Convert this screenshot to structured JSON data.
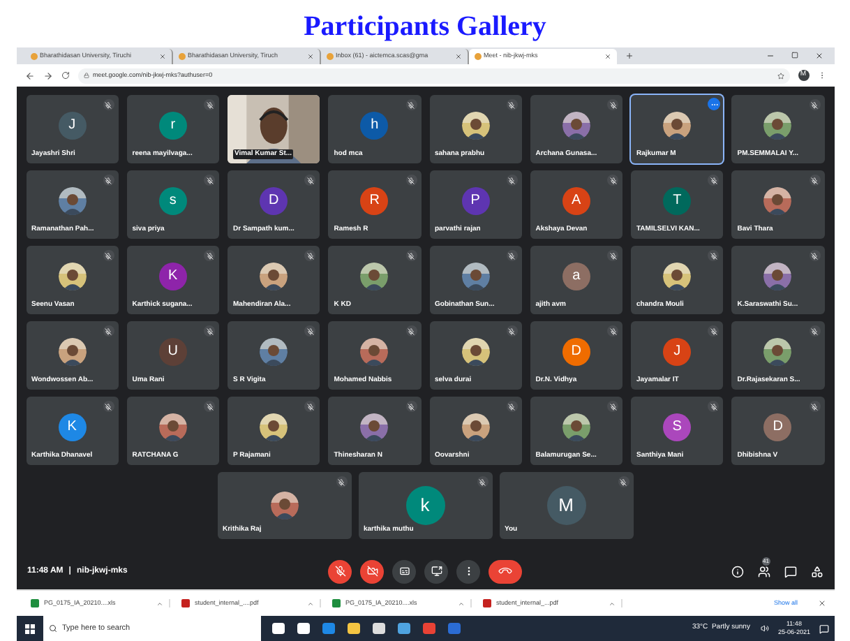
{
  "heading": "Participants Gallery",
  "browser": {
    "tabs": [
      {
        "title": "Bharathidasan University, Tiruchi",
        "selected": false
      },
      {
        "title": "Bharathidasan University, Tiruch",
        "selected": false
      },
      {
        "title": "Inbox (61) - aictemca.scas@gma",
        "selected": false
      },
      {
        "title": "Meet - nib-jkwj-mks",
        "selected": true
      }
    ],
    "url": "meet.google.com/nib-jkwj-mks?authuser=0",
    "profile": "M"
  },
  "participants": [
    {
      "name": "Jayashri Shri",
      "highlighted": false,
      "avatar": {
        "kind": "letter",
        "letter": "J",
        "color": "#455a64"
      }
    },
    {
      "name": "reena mayilvaga...",
      "highlighted": false,
      "avatar": {
        "kind": "letter",
        "letter": "r",
        "color": "#00897b"
      }
    },
    {
      "name": "Vimal Kumar St...",
      "highlighted": false,
      "avatar": {
        "kind": "video"
      }
    },
    {
      "name": "hod mca",
      "highlighted": false,
      "avatar": {
        "kind": "letter",
        "letter": "h",
        "color": "#0d5aa7"
      }
    },
    {
      "name": "sahana prabhu",
      "highlighted": false
    },
    {
      "name": "Archana Gunasa...",
      "highlighted": false
    },
    {
      "name": "Rajkumar M",
      "highlighted": true
    },
    {
      "name": "PM.SEMMALAI Y...",
      "highlighted": false
    },
    {
      "name": "Ramanathan Pah...",
      "highlighted": false
    },
    {
      "name": "siva priya",
      "highlighted": false,
      "avatar": {
        "kind": "letter",
        "letter": "s",
        "color": "#00897b"
      }
    },
    {
      "name": "Dr Sampath kum...",
      "highlighted": false,
      "avatar": {
        "kind": "letter",
        "letter": "D",
        "color": "#5e35b1"
      }
    },
    {
      "name": "Ramesh R",
      "highlighted": false,
      "avatar": {
        "kind": "letter",
        "letter": "R",
        "color": "#d84315"
      }
    },
    {
      "name": "parvathi rajan",
      "highlighted": false,
      "avatar": {
        "kind": "letter",
        "letter": "P",
        "color": "#5e35b1"
      }
    },
    {
      "name": "Akshaya Devan",
      "highlighted": false,
      "avatar": {
        "kind": "letter",
        "letter": "A",
        "color": "#d84315"
      }
    },
    {
      "name": "TAMILSELVI KAN...",
      "highlighted": false,
      "avatar": {
        "kind": "letter",
        "letter": "T",
        "color": "#00695c"
      }
    },
    {
      "name": "Bavi Thara",
      "highlighted": false
    },
    {
      "name": "Seenu Vasan",
      "highlighted": false
    },
    {
      "name": "Karthick sugana...",
      "highlighted": false,
      "avatar": {
        "kind": "letter",
        "letter": "K",
        "color": "#8e24aa"
      }
    },
    {
      "name": "Mahendiran Ala...",
      "highlighted": false
    },
    {
      "name": "K KD",
      "highlighted": false
    },
    {
      "name": "Gobinathan Sun...",
      "highlighted": false
    },
    {
      "name": "ajith avm",
      "highlighted": false,
      "avatar": {
        "kind": "letter",
        "letter": "a",
        "color": "#8d6e63"
      }
    },
    {
      "name": "chandra Mouli",
      "highlighted": false
    },
    {
      "name": "K.Saraswathi Su...",
      "highlighted": false
    },
    {
      "name": "Wondwossen Ab...",
      "highlighted": false
    },
    {
      "name": "Uma Rani",
      "highlighted": false,
      "avatar": {
        "kind": "letter",
        "letter": "U",
        "color": "#5d4037"
      }
    },
    {
      "name": "S R Vigita",
      "highlighted": false
    },
    {
      "name": "Mohamed Nabbis",
      "highlighted": false
    },
    {
      "name": "selva durai",
      "highlighted": false
    },
    {
      "name": "Dr.N. Vidhya",
      "highlighted": false,
      "avatar": {
        "kind": "letter",
        "letter": "D",
        "color": "#ef6c00"
      }
    },
    {
      "name": "Jayamalar IT",
      "highlighted": false,
      "avatar": {
        "kind": "letter",
        "letter": "J",
        "color": "#d84315"
      }
    },
    {
      "name": "Dr.Rajasekaran S...",
      "highlighted": false
    },
    {
      "name": "Karthika Dhanavel",
      "highlighted": false,
      "avatar": {
        "kind": "letter",
        "letter": "K",
        "color": "#1e88e5"
      }
    },
    {
      "name": "RATCHANA G",
      "highlighted": false
    },
    {
      "name": "P Rajamani",
      "highlighted": false
    },
    {
      "name": "Thinesharan N",
      "highlighted": false
    },
    {
      "name": "Oovarshni",
      "highlighted": false
    },
    {
      "name": "Balamurugan Se...",
      "highlighted": false
    },
    {
      "name": "Santhiya Mani",
      "highlighted": false,
      "avatar": {
        "kind": "letter",
        "letter": "S",
        "color": "#ab47bc"
      }
    },
    {
      "name": "Dhibishna V",
      "highlighted": false,
      "avatar": {
        "kind": "letter",
        "letter": "D",
        "color": "#8d6e63"
      }
    }
  ],
  "last_row": [
    {
      "name": "Krithika Raj",
      "highlighted": false
    },
    {
      "name": "karthika muthu",
      "highlighted": false,
      "avatar": {
        "kind": "letter",
        "letter": "k",
        "color": "#00897b"
      }
    },
    {
      "name": "You",
      "highlighted": false,
      "avatar": {
        "kind": "letter",
        "letter": "M",
        "color": "#455a64"
      }
    }
  ],
  "meeting": {
    "time": "11:48 AM",
    "separator": "|",
    "code": "nib-jkwj-mks",
    "participant_count": "41"
  },
  "downloads": {
    "files": [
      {
        "name": "PG_0175_IA_20210....xls",
        "kind": "sheet"
      },
      {
        "name": "student_internal_....pdf",
        "kind": "pdf"
      },
      {
        "name": "PG_0175_IA_20210....xls",
        "kind": "sheet"
      },
      {
        "name": "student_internal_...pdf",
        "kind": "pdf"
      }
    ],
    "show_all": "Show all"
  },
  "taskbar": {
    "search_placeholder": "Type here to search",
    "weather": "33°C  Partly sunny",
    "time": "11:48",
    "date": "25-06-2021"
  }
}
